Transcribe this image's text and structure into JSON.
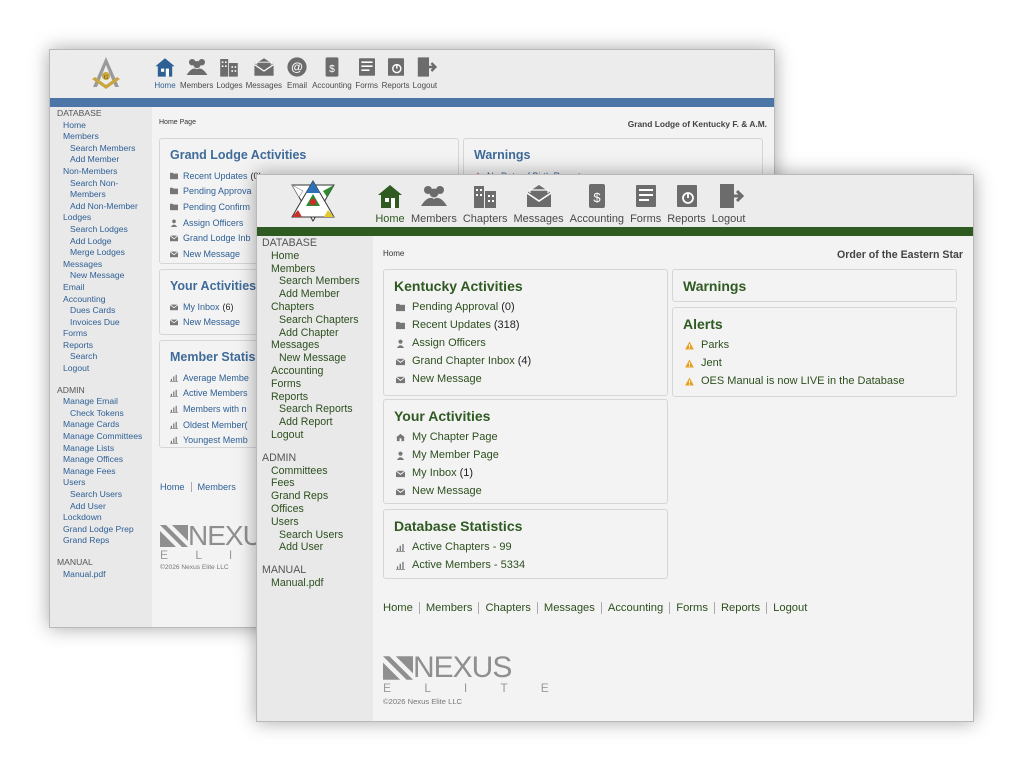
{
  "colors": {
    "back_accent": "#4d76a8",
    "front_accent": "#2f5a22",
    "alert": "#e8a020",
    "warning": "#c8302b"
  },
  "back": {
    "nav": [
      {
        "label": "Home",
        "icon": "house-icon"
      },
      {
        "label": "Members",
        "icon": "members-icon"
      },
      {
        "label": "Lodges",
        "icon": "building-icon"
      },
      {
        "label": "Messages",
        "icon": "envelope-icon"
      },
      {
        "label": "Email",
        "icon": "at-icon"
      },
      {
        "label": "Accounting",
        "icon": "dollar-icon"
      },
      {
        "label": "Forms",
        "icon": "form-icon"
      },
      {
        "label": "Reports",
        "icon": "report-icon"
      },
      {
        "label": "Logout",
        "icon": "logout-icon"
      }
    ],
    "sidebar": [
      {
        "text": "DATABASE",
        "level": 0
      },
      {
        "text": "Home",
        "level": 1
      },
      {
        "text": "Members",
        "level": 1
      },
      {
        "text": "Search Members",
        "level": 2
      },
      {
        "text": "Add Member",
        "level": 2
      },
      {
        "text": "Non-Members",
        "level": 1
      },
      {
        "text": "Search Non-",
        "level": 2
      },
      {
        "text": "Members",
        "level": 2
      },
      {
        "text": "Add Non-Member",
        "level": 2
      },
      {
        "text": "Lodges",
        "level": 1
      },
      {
        "text": "Search Lodges",
        "level": 2
      },
      {
        "text": "Add Lodge",
        "level": 2
      },
      {
        "text": "Merge Lodges",
        "level": 2
      },
      {
        "text": "Messages",
        "level": 1
      },
      {
        "text": "New Message",
        "level": 2
      },
      {
        "text": "Email",
        "level": 1
      },
      {
        "text": "Accounting",
        "level": 1
      },
      {
        "text": "Dues Cards",
        "level": 2
      },
      {
        "text": "Invoices Due",
        "level": 2
      },
      {
        "text": "Forms",
        "level": 1
      },
      {
        "text": "Reports",
        "level": 1
      },
      {
        "text": "Search",
        "level": 2
      },
      {
        "text": "Logout",
        "level": 1
      },
      {
        "text": "",
        "level": 0
      },
      {
        "text": "ADMIN",
        "level": 0
      },
      {
        "text": "Manage Email",
        "level": 1
      },
      {
        "text": "Check Tokens",
        "level": 2
      },
      {
        "text": "Manage Cards",
        "level": 1
      },
      {
        "text": "Manage Committees",
        "level": 1
      },
      {
        "text": "Manage Lists",
        "level": 1
      },
      {
        "text": "Manage Offices",
        "level": 1
      },
      {
        "text": "Manage Fees",
        "level": 1
      },
      {
        "text": "Users",
        "level": 1
      },
      {
        "text": "Search Users",
        "level": 2
      },
      {
        "text": "Add User",
        "level": 2
      },
      {
        "text": "Lockdown",
        "level": 1
      },
      {
        "text": "Grand Lodge Prep",
        "level": 1
      },
      {
        "text": "Grand Reps",
        "level": 1
      },
      {
        "text": "",
        "level": 0
      },
      {
        "text": "MANUAL",
        "level": 0
      },
      {
        "text": "Manual.pdf",
        "level": 1
      }
    ],
    "breadcrumb": "Home Page",
    "org": "Grand Lodge of Kentucky F. & A.M.",
    "grand_lodge_activities": {
      "title": "Grand Lodge Activities",
      "items": [
        {
          "label": "Recent Updates",
          "count": "(0)",
          "icon": "folder-icon"
        },
        {
          "label": "Pending Approva",
          "count": "",
          "icon": "folder-icon"
        },
        {
          "label": "Pending Confirm",
          "count": "",
          "icon": "folder-icon"
        },
        {
          "label": "Assign Officers",
          "count": "",
          "icon": "person-icon"
        },
        {
          "label": "Grand Lodge Inb",
          "count": "",
          "icon": "envelope-icon"
        },
        {
          "label": "New Message",
          "count": "",
          "icon": "envelope-icon"
        }
      ]
    },
    "warnings": {
      "title": "Warnings",
      "items": [
        {
          "label": "No Date of Birth Report",
          "icon": "warning-icon"
        }
      ]
    },
    "your_activities": {
      "title": "Your Activities",
      "items": [
        {
          "label": "My Inbox",
          "count": "(6)",
          "icon": "envelope-icon"
        },
        {
          "label": "New Message",
          "count": "",
          "icon": "envelope-icon"
        }
      ]
    },
    "member_statistics": {
      "title": "Member Statis",
      "items": [
        {
          "label": "Average Membe",
          "icon": "chart-icon"
        },
        {
          "label": "Active Members",
          "icon": "chart-icon"
        },
        {
          "label": "Members with n",
          "icon": "chart-icon"
        },
        {
          "label": "Oldest Member(",
          "icon": "chart-icon"
        },
        {
          "label": "Youngest Memb",
          "icon": "chart-icon"
        }
      ]
    },
    "footer_nav": [
      "Home",
      "Members"
    ],
    "brand": {
      "word": "NEXUS",
      "sub": "E L I T E",
      "copyright": "©2026 Nexus Elite LLC"
    }
  },
  "front": {
    "nav": [
      {
        "label": "Home",
        "icon": "house-icon"
      },
      {
        "label": "Members",
        "icon": "members-icon"
      },
      {
        "label": "Chapters",
        "icon": "building-icon"
      },
      {
        "label": "Messages",
        "icon": "envelope-icon"
      },
      {
        "label": "Accounting",
        "icon": "dollar-icon"
      },
      {
        "label": "Forms",
        "icon": "form-icon"
      },
      {
        "label": "Reports",
        "icon": "report-icon"
      },
      {
        "label": "Logout",
        "icon": "logout-icon"
      }
    ],
    "sidebar": [
      {
        "text": "DATABASE",
        "level": 0
      },
      {
        "text": "Home",
        "level": 1
      },
      {
        "text": "Members",
        "level": 1
      },
      {
        "text": "Search Members",
        "level": 2
      },
      {
        "text": "Add Member",
        "level": 2
      },
      {
        "text": "Chapters",
        "level": 1
      },
      {
        "text": "Search Chapters",
        "level": 2
      },
      {
        "text": "Add Chapter",
        "level": 2
      },
      {
        "text": "Messages",
        "level": 1
      },
      {
        "text": "New Message",
        "level": 2
      },
      {
        "text": "Accounting",
        "level": 1
      },
      {
        "text": "Forms",
        "level": 1
      },
      {
        "text": "Reports",
        "level": 1
      },
      {
        "text": "Search Reports",
        "level": 2
      },
      {
        "text": "Add Report",
        "level": 2
      },
      {
        "text": "Logout",
        "level": 1
      },
      {
        "text": "",
        "level": 0
      },
      {
        "text": "ADMIN",
        "level": 0
      },
      {
        "text": "Committees",
        "level": 1
      },
      {
        "text": "Fees",
        "level": 1
      },
      {
        "text": "Grand Reps",
        "level": 1
      },
      {
        "text": "Offices",
        "level": 1
      },
      {
        "text": "Users",
        "level": 1
      },
      {
        "text": "Search Users",
        "level": 2
      },
      {
        "text": "Add User",
        "level": 2
      },
      {
        "text": "",
        "level": 0
      },
      {
        "text": "MANUAL",
        "level": 0
      },
      {
        "text": "Manual.pdf",
        "level": 1
      }
    ],
    "breadcrumb": "Home",
    "org": "Order of the Eastern Star",
    "kentucky_activities": {
      "title": "Kentucky Activities",
      "items": [
        {
          "label": "Pending Approval",
          "count": "(0)",
          "icon": "folder-icon"
        },
        {
          "label": "Recent Updates",
          "count": "(318)",
          "icon": "folder-icon"
        },
        {
          "label": "Assign Officers",
          "count": "",
          "icon": "person-icon"
        },
        {
          "label": "Grand Chapter Inbox",
          "count": "(4)",
          "icon": "envelope-icon"
        },
        {
          "label": "New Message",
          "count": "",
          "icon": "envelope-icon"
        }
      ]
    },
    "your_activities": {
      "title": "Your Activities",
      "items": [
        {
          "label": "My Chapter Page",
          "count": "",
          "icon": "house-icon"
        },
        {
          "label": "My Member Page",
          "count": "",
          "icon": "person-icon"
        },
        {
          "label": "My Inbox",
          "count": "(1)",
          "icon": "envelope-icon"
        },
        {
          "label": "New Message",
          "count": "",
          "icon": "envelope-icon"
        }
      ]
    },
    "database_statistics": {
      "title": "Database Statistics",
      "items": [
        {
          "label": "Active Chapters - 99",
          "count": "",
          "icon": "chart-icon"
        },
        {
          "label": "Active Members - 5334",
          "count": "",
          "icon": "chart-icon"
        }
      ]
    },
    "warnings": {
      "title": "Warnings"
    },
    "alerts": {
      "title": "Alerts",
      "items": [
        {
          "label": "Parks",
          "icon": "alert-icon"
        },
        {
          "label": "Jent",
          "icon": "alert-icon"
        },
        {
          "label": "OES Manual is now LIVE in the Database",
          "icon": "alert-icon"
        }
      ]
    },
    "footer_nav": [
      "Home",
      "Members",
      "Chapters",
      "Messages",
      "Accounting",
      "Forms",
      "Reports",
      "Logout"
    ],
    "brand": {
      "word": "NEXUS",
      "sub": "E L I T E",
      "copyright": "©2026 Nexus Elite LLC"
    }
  }
}
